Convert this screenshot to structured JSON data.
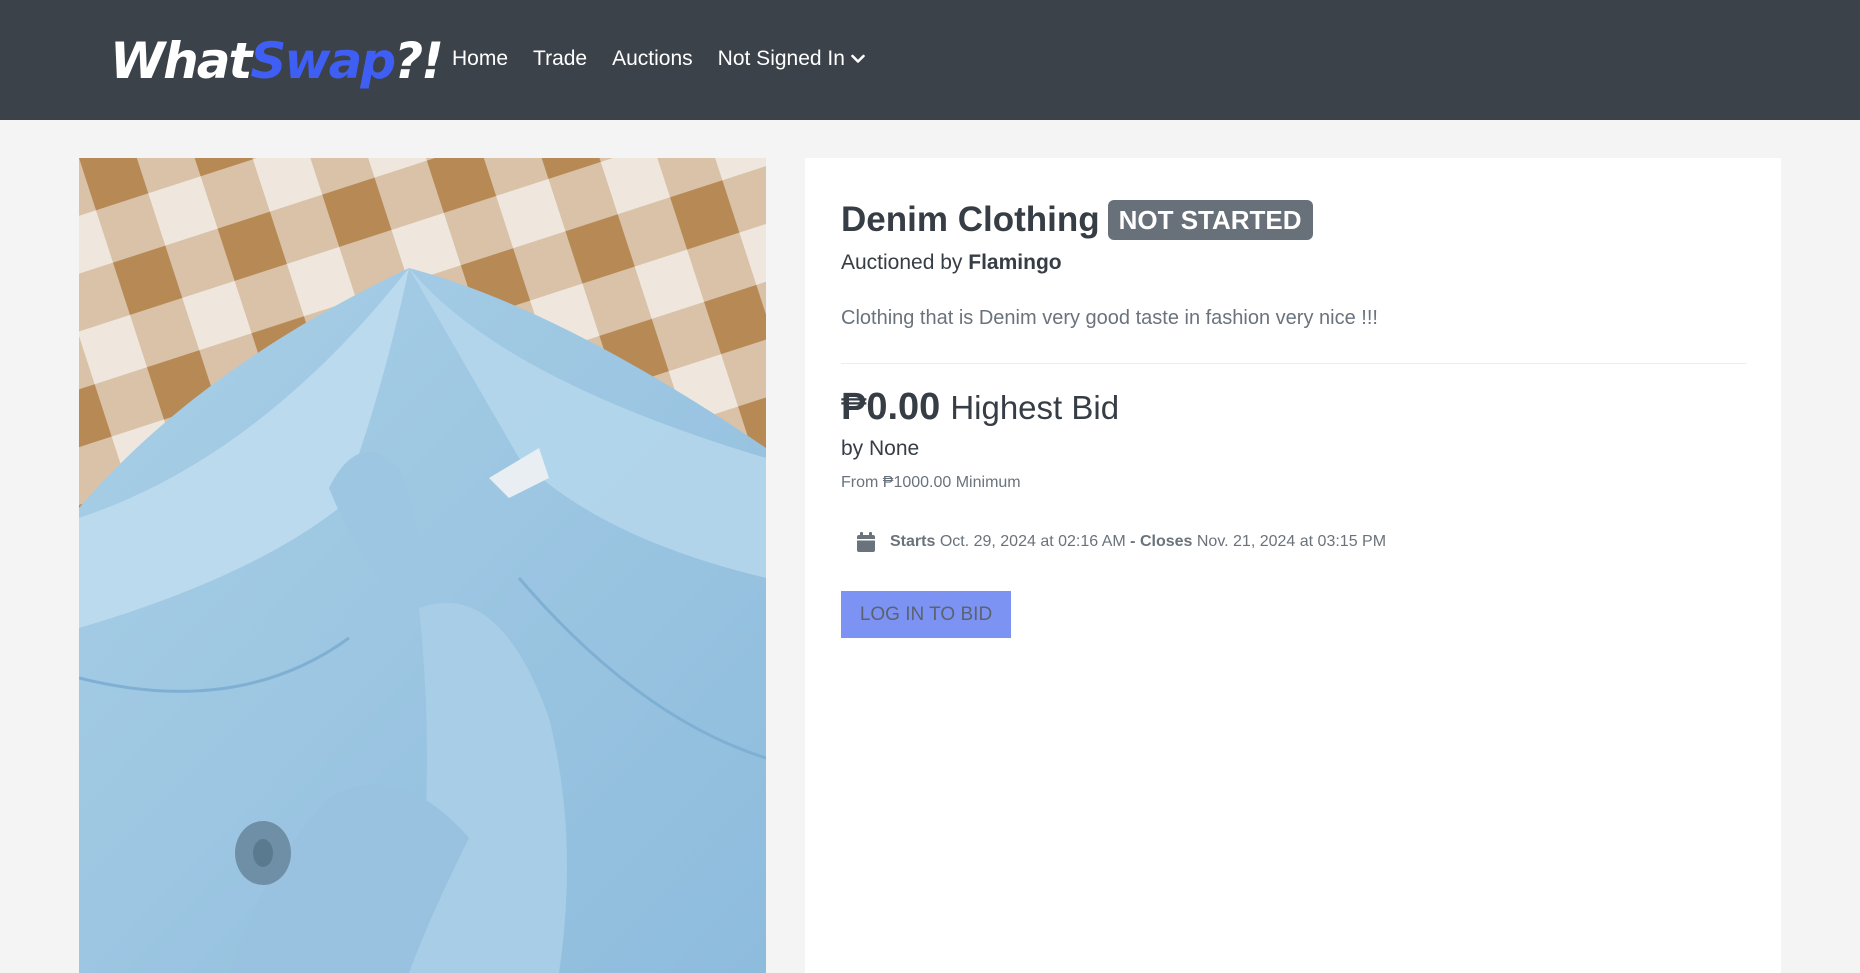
{
  "navbar": {
    "logo_part1": "What",
    "logo_part2": "Swap",
    "logo_part3": "?!",
    "links": [
      {
        "label": "Home"
      },
      {
        "label": "Trade"
      },
      {
        "label": "Auctions"
      },
      {
        "label": "Not Signed In"
      }
    ]
  },
  "listing": {
    "image_alt": "Light blue denim shirt collar on a checkered blanket",
    "title": "Denim Clothing",
    "status_badge": "NOT STARTED",
    "auctioned_by_prefix": "Auctioned by",
    "auctioneer": "Flamingo",
    "description": "Clothing that is Denim very good taste in fashion very nice !!!",
    "highest_bid_amount": "₱0.00",
    "highest_bid_label": "Highest Bid",
    "bidder_text": "by None",
    "minimum_text": "From ₱1000.00 Minimum",
    "starts_label": "Starts",
    "starts_value": "Oct. 29, 2024 at 02:16 AM",
    "separator": "-",
    "closes_label": "Closes",
    "closes_value": "Nov. 21, 2024 at 03:15 PM",
    "bid_button": "LOG IN TO BID"
  },
  "colors": {
    "navbar_bg": "#3b424a",
    "brand_accent": "#3f5ef3",
    "badge_bg": "#687079",
    "button_bg": "#7d93f4"
  }
}
